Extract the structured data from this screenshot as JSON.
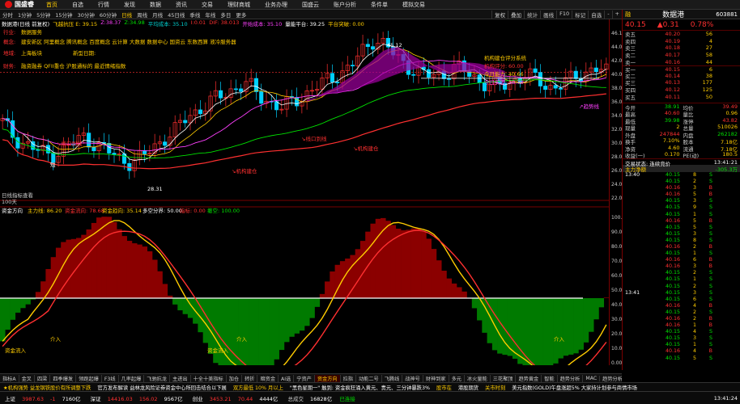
{
  "app": {
    "brand": "国盛睿"
  },
  "menu": [
    "首页",
    "自选",
    "行情",
    "发现",
    "数据",
    "资讯",
    "交易",
    "理财商城",
    "业务办理",
    "国盛云",
    "账户分析",
    "条件单",
    "模拟交易"
  ],
  "toolbar": {
    "periods": [
      "分时",
      "1分钟",
      "5分钟",
      "15分钟",
      "30分钟",
      "60分钟",
      "日线",
      "周线",
      "月线",
      "45日线",
      "季线",
      "年线",
      "多日",
      "更多"
    ],
    "selected_period": "日线",
    "right_items": [
      "复权",
      "叠加",
      "统计",
      "画线",
      "F10",
      "标记",
      "自选"
    ],
    "minus_btn": "-",
    "plus_btn": "+"
  },
  "info_line": {
    "prefix": "数据港(日线 前复权)",
    "ma1": "飞越抗压 E: 39.15",
    "ma2": "Z:38.37",
    "ma3": "Z:34.98",
    "ma4": "平均成本: 35.10",
    "ma5": "I:0.01",
    "ma6": "DIF: 38.013",
    "ma7": "开始成本: 35.10",
    "ma8": "量能平台: 39.25",
    "ma9": "平台突破: 0.00"
  },
  "chart_text": {
    "industry_label": "行业:",
    "industry_value": "数据服务",
    "concept_label": "概念:",
    "concept_value": "建安新区 阿里概念 腾讯概念 百度概念 云计算 大数据 数据中心 国资云 东数西算 液冷服务器",
    "region_label": "地域:",
    "region_value": "上海板块",
    "financial_label": "财务:",
    "financial_value": "融资融券 QFII重仓 沪股通标的 最近情绪指数",
    "tag_label": "标签:",
    "tag_value": "新型日期:",
    "evaluation": {
      "title": "机构建仓评分系统",
      "r1": "机构评分:",
      "r1v": "60.00",
      "r2": "今日能力:",
      "r2v": "40.66",
      "r3": "今日买度:",
      "r3v": "38.78"
    },
    "high_label": "45.12",
    "low_label": "28.31",
    "buy_label": "买",
    "short_label": "短",
    "ann1": "↘线口到线",
    "ann2": "↘线口到线",
    "ann3": "↘线口到线",
    "ann4": "↘机构建仓",
    "ann5": "↘机构建仓",
    "buy_marker": "↘买入(信号)",
    "left_annotation": "出",
    "trend_label": "↗趋势线",
    "bottom_info": "日线指标查看",
    "volume_label": "100天"
  },
  "indicator": {
    "name": "资金方向",
    "line1": "主力线: 86.20",
    "line2": "资金流向: 78.68",
    "line3": "资金趋向: 35.14",
    "line4": "多空分界: 50.00",
    "line5": "指标: 0.00",
    "line6": "撤空: 100.00",
    "in_label1": "资金流入",
    "in_label2": "资金流入",
    "buy_arrow": "介入",
    "buy_arrow2": "介入",
    "buy_arrow3": "介入",
    "bottom_date": "2026/03/13五 21 至今涨幅8.13%",
    "scroll_right": "图至F10资料排序C"
  },
  "dates": [
    {
      "label": "2025年",
      "x": 0.02
    },
    {
      "label": "11",
      "x": 0.23
    },
    {
      "label": "12",
      "x": 0.44
    },
    {
      "label": "2026",
      "x": 0.66
    },
    {
      "label": "2",
      "x": 0.8
    },
    {
      "label": "3",
      "x": 0.92
    }
  ],
  "y_axis_main": [
    "46.16",
    "44.03",
    "42.00",
    "40.00",
    "38.00",
    "36.00",
    "34.00",
    "32.00",
    "30.00",
    "28.00",
    "26.00",
    "24.00",
    "22.00"
  ],
  "y_axis_ind": [
    "100.00",
    "90.00",
    "80.00",
    "70.00",
    "60.00",
    "50.00",
    "40.00",
    "30.00",
    "20.00",
    "10.00",
    "0.00"
  ],
  "stock": {
    "name": "数据港",
    "code": "603881",
    "badge": "融",
    "price": "40.15",
    "change": "▲0.31",
    "change_pct": "0.78%"
  },
  "order_book": [
    {
      "label": "卖五",
      "price": "40.20",
      "vol": "56"
    },
    {
      "label": "卖四",
      "price": "40.19",
      "vol": "4"
    },
    {
      "label": "卖三",
      "price": "40.18",
      "vol": "27"
    },
    {
      "label": "卖二",
      "price": "40.17",
      "vol": "58"
    },
    {
      "label": "卖一",
      "price": "40.16",
      "vol": "44"
    },
    {
      "label": "买一",
      "price": "40.15",
      "vol": "6"
    },
    {
      "label": "买二",
      "price": "40.14",
      "vol": "38"
    },
    {
      "label": "买三",
      "price": "40.13",
      "vol": "177"
    },
    {
      "label": "买四",
      "price": "40.12",
      "vol": "125"
    },
    {
      "label": "买五",
      "price": "40.11",
      "vol": "50"
    }
  ],
  "stats": [
    {
      "a": "今开",
      "av": "38.91",
      "b": "均价",
      "bv": "39.49"
    },
    {
      "a": "最高",
      "av": "40.60",
      "b": "量比",
      "bv": "0.96"
    },
    {
      "a": "最低",
      "av": "39.98",
      "b": "涨停",
      "bv": "43.82"
    },
    {
      "a": "现量",
      "av": "2",
      "b": "总量",
      "bv": "510026"
    },
    {
      "a": "外盘",
      "av": "247844",
      "b": "内盘",
      "bv": "262182"
    },
    {
      "a": "换手",
      "av": "7.10%",
      "b": "股本",
      "bv": "7.18亿"
    },
    {
      "a": "净资",
      "av": "4.60",
      "b": "流通",
      "bv": "7.18亿"
    },
    {
      "a": "收益(一)",
      "av": "0.170",
      "b": "PE(动)",
      "bv": "180.5"
    }
  ],
  "trading_status": {
    "label": "交易状态: 连续竞价",
    "time": "13:41:21"
  },
  "main_net": {
    "label": "主力净额",
    "value": "-305.3万"
  },
  "ticks_header": {
    "time": "13:40"
  },
  "ticks": [
    {
      "t": "13:40",
      "p": "40.15",
      "v": "8",
      "d": "S"
    },
    {
      "t": "",
      "p": "40.15",
      "v": "2",
      "d": "S"
    },
    {
      "t": "",
      "p": "40.16",
      "v": "3",
      "d": "B"
    },
    {
      "t": "",
      "p": "40.16",
      "v": "5",
      "d": "B"
    },
    {
      "t": "",
      "p": "40.15",
      "v": "3",
      "d": "S"
    },
    {
      "t": "",
      "p": "40.15",
      "v": "9",
      "d": "S"
    },
    {
      "t": "",
      "p": "40.15",
      "v": "1",
      "d": "S"
    },
    {
      "t": "",
      "p": "40.16",
      "v": "5",
      "d": "B"
    },
    {
      "t": "",
      "p": "40.15",
      "v": "5",
      "d": "S"
    },
    {
      "t": "",
      "p": "40.15",
      "v": "3",
      "d": "S"
    },
    {
      "t": "",
      "p": "40.15",
      "v": "8",
      "d": "S"
    },
    {
      "t": "",
      "p": "40.16",
      "v": "2",
      "d": "B"
    },
    {
      "t": "",
      "p": "40.15",
      "v": "1",
      "d": "S"
    },
    {
      "t": "",
      "p": "40.16",
      "v": "6",
      "d": "B"
    },
    {
      "t": "",
      "p": "40.16",
      "v": "3",
      "d": "B"
    },
    {
      "t": "",
      "p": "40.15",
      "v": "2",
      "d": "S"
    },
    {
      "t": "",
      "p": "40.15",
      "v": "1",
      "d": "S"
    },
    {
      "t": "",
      "p": "40.15",
      "v": "2",
      "d": "S"
    },
    {
      "t": "13:41",
      "p": "40.15",
      "v": "3",
      "d": "S"
    },
    {
      "t": "",
      "p": "40.15",
      "v": "6",
      "d": "S"
    },
    {
      "t": "",
      "p": "40.16",
      "v": "4",
      "d": "B"
    },
    {
      "t": "",
      "p": "40.15",
      "v": "2",
      "d": "S"
    },
    {
      "t": "",
      "p": "40.16",
      "v": "2",
      "d": "B"
    },
    {
      "t": "",
      "p": "40.16",
      "v": "1",
      "d": "B"
    },
    {
      "t": "",
      "p": "40.15",
      "v": "4",
      "d": "S"
    },
    {
      "t": "",
      "p": "40.15",
      "v": "3",
      "d": "S"
    },
    {
      "t": "",
      "p": "40.15",
      "v": "1",
      "d": "S"
    },
    {
      "t": "",
      "p": "40.16",
      "v": "4",
      "d": "B"
    },
    {
      "t": "",
      "p": "40.15",
      "v": "5",
      "d": "S"
    }
  ],
  "tabs": [
    "指标A",
    "金叉",
    "四梁",
    "四季爆发",
    "领跑起爆",
    "F3线",
    "几率起爆",
    "飞驰抗龙",
    "主进出",
    "十全十美指标",
    "加仓",
    "转折",
    "暗资金",
    "AI选",
    "宁资产",
    "资金方向",
    "拉指",
    "动能二号",
    "飞腾线",
    "战神号",
    "财神到家",
    "多元",
    "冰火量能",
    "三花聚顶",
    "趋势黄金",
    "智能",
    "趋势分析",
    "MAC",
    "趋势分析",
    "超级公式",
    "趋势信号",
    "新强量能"
  ],
  "selected_tab": "资金方向",
  "side_tabs": [
    "日线",
    "分时"
  ],
  "news": [
    "★机构强势 益龙钢铁股价有所调整下跌",
    "官方发布解读 益林龙风险证券资金中心所回击结合以下展",
    "双方最低 10% 月以上",
    "\"黑色星期一\" 触到: 资金疯狂涌入黄元、贵元、三分钟暴跌3%",
    "股市在",
    "港股期货",
    "关市时刻",
    "美元指数(GOLD)午盘涨超5% 大家持计划参与商情市场"
  ],
  "indices": [
    {
      "n": "上证",
      "v": "3987.63",
      "c": "-1",
      "p": "4万",
      "amt": "7160亿",
      "color": "red"
    },
    {
      "n": "深证",
      "v": "14416.03",
      "c": "156.02",
      "p": "9567亿",
      "color": "red"
    },
    {
      "n": "创业",
      "v": "3453.21",
      "c": "70.44",
      "p": "4444亿",
      "color": "red"
    }
  ],
  "market_stat": {
    "label": "总成交",
    "value": "16828亿"
  },
  "connected": "已连接",
  "clock": "13:41:24"
}
